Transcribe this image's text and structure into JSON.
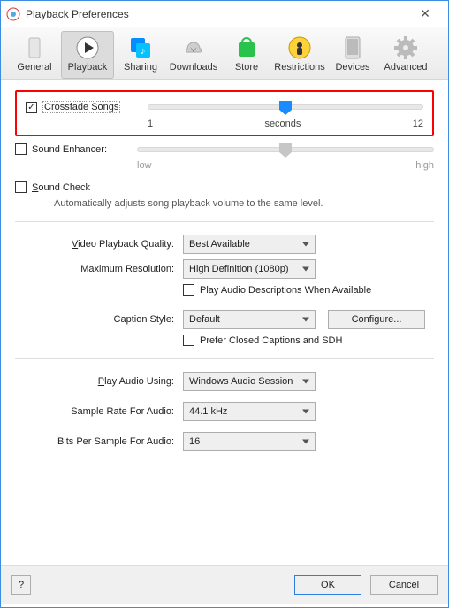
{
  "window": {
    "title": "Playback Preferences"
  },
  "toolbar": {
    "items": [
      {
        "label": "General"
      },
      {
        "label": "Playback"
      },
      {
        "label": "Sharing"
      },
      {
        "label": "Downloads"
      },
      {
        "label": "Store"
      },
      {
        "label": "Restrictions"
      },
      {
        "label": "Devices"
      },
      {
        "label": "Advanced"
      }
    ]
  },
  "crossfade": {
    "label": "Crossfade Songs",
    "min": "1",
    "unit": "seconds",
    "max": "12"
  },
  "soundEnhancer": {
    "label": "Sound Enhancer:",
    "low": "low",
    "high": "high"
  },
  "soundCheck": {
    "label": "Sound Check",
    "desc": "Automatically adjusts song playback volume to the same level."
  },
  "video": {
    "qualityLabel": "Video Playback Quality:",
    "qualityValue": "Best Available",
    "maxResLabel": "Maximum Resolution:",
    "maxResValue": "High Definition (1080p)",
    "audioDescLabel": "Play Audio Descriptions When Available",
    "captionStyleLabel": "Caption Style:",
    "captionStyleValue": "Default",
    "configureLabel": "Configure...",
    "preferCCLabel": "Prefer Closed Captions and SDH"
  },
  "audio": {
    "playUsingLabel": "Play Audio Using:",
    "playUsingValue": "Windows Audio Session",
    "sampleRateLabel": "Sample Rate For Audio:",
    "sampleRateValue": "44.1 kHz",
    "bitsLabel": "Bits Per Sample For Audio:",
    "bitsValue": "16"
  },
  "footer": {
    "help": "?",
    "ok": "OK",
    "cancel": "Cancel"
  }
}
